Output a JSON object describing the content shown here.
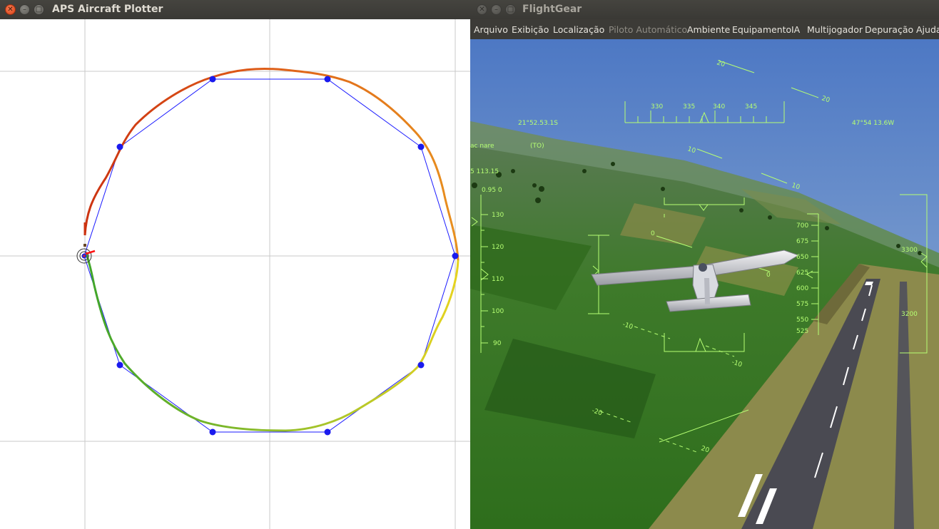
{
  "plotter": {
    "title": "APS Aircraft Plotter",
    "close_glyph": "✕",
    "min_glyph": "–",
    "max_glyph": "□"
  },
  "flightgear": {
    "title": "FlightGear",
    "close_glyph": "✕",
    "min_glyph": "–",
    "max_glyph": "□",
    "menu": [
      "Arquivo",
      "Exibição",
      "Localização",
      "Piloto Automático",
      "Ambiente",
      "Equipamento",
      "IA",
      "Multijogador",
      "Depuração",
      "Ajuda"
    ],
    "disabled_menu": "Piloto Automático",
    "hud": {
      "latitude": "21°52.53.1S",
      "longitude": "47°54 13.6W",
      "heading_scale": [
        "330",
        "335",
        "340",
        "345"
      ],
      "mode_left": "ac nare",
      "mode_to": "(TO)",
      "left_readout_1": "5 113.15",
      "left_readout_2": "0.95 0",
      "speed_scale": [
        "130",
        "120",
        "110",
        "100",
        "90"
      ],
      "altitude_scale": [
        "700",
        "675",
        "650",
        "625",
        "600",
        "575",
        "550",
        "525"
      ],
      "far_right_scale": [
        "3300",
        "3200"
      ],
      "pitch_labels": [
        "20",
        "20",
        "10",
        "10",
        "0",
        "0",
        "-10",
        "-10",
        "-20",
        "20"
      ]
    }
  },
  "colors": {
    "route": "#1a1aff",
    "waypoint": "#1a1aee",
    "track_start": "#cc3311",
    "track_mid": "#e8901f",
    "track_yellow": "#e6d31f",
    "track_end": "#3fa52a",
    "hud": "#b6ff73"
  }
}
